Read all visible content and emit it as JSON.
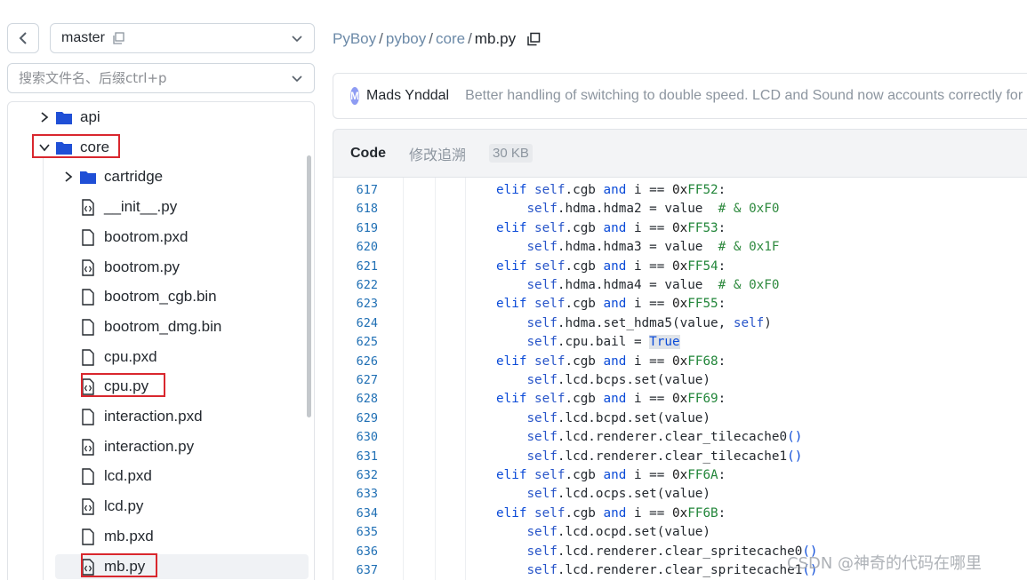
{
  "sidebar": {
    "branch": "master",
    "search_placeholder": "搜索文件名、后缀ctrl+p",
    "tree": [
      {
        "label": "api",
        "type": "folder",
        "expanded": false,
        "selected": false,
        "highlighted": false
      },
      {
        "label": "core",
        "type": "folder",
        "expanded": true,
        "selected": false,
        "highlighted": true
      },
      {
        "label": "cartridge",
        "type": "folder",
        "expanded": false,
        "selected": false,
        "highlighted": false
      },
      {
        "label": "__init__.py",
        "type": "code-file",
        "selected": false,
        "highlighted": false
      },
      {
        "label": "bootrom.pxd",
        "type": "file",
        "selected": false,
        "highlighted": false
      },
      {
        "label": "bootrom.py",
        "type": "code-file",
        "selected": false,
        "highlighted": false
      },
      {
        "label": "bootrom_cgb.bin",
        "type": "file",
        "selected": false,
        "highlighted": false
      },
      {
        "label": "bootrom_dmg.bin",
        "type": "file",
        "selected": false,
        "highlighted": false
      },
      {
        "label": "cpu.pxd",
        "type": "file",
        "selected": false,
        "highlighted": false
      },
      {
        "label": "cpu.py",
        "type": "code-file",
        "selected": false,
        "highlighted": true
      },
      {
        "label": "interaction.pxd",
        "type": "file",
        "selected": false,
        "highlighted": false
      },
      {
        "label": "interaction.py",
        "type": "code-file",
        "selected": false,
        "highlighted": false
      },
      {
        "label": "lcd.pxd",
        "type": "file",
        "selected": false,
        "highlighted": false
      },
      {
        "label": "lcd.py",
        "type": "code-file",
        "selected": false,
        "highlighted": false
      },
      {
        "label": "mb.pxd",
        "type": "file",
        "selected": false,
        "highlighted": false
      },
      {
        "label": "mb.py",
        "type": "code-file",
        "selected": true,
        "highlighted": true
      }
    ]
  },
  "breadcrumb": {
    "parts": [
      "PyBoy",
      "pyboy",
      "core"
    ],
    "separator": "/",
    "current": "mb.py"
  },
  "commit": {
    "avatar_letter": "M",
    "author": "Mads Ynddal",
    "message": "Better handling of switching to double speed. LCD and Sound now accounts correctly for double speed"
  },
  "code_header": {
    "tab_code": "Code",
    "tab_blame": "修改追溯",
    "size": "30 KB"
  },
  "code": {
    "lines": [
      {
        "n": "617",
        "t": "elif self.cgb and i == 0xFF52:"
      },
      {
        "n": "618",
        "t": "    self.hdma.hdma2 = value  # & 0xF0"
      },
      {
        "n": "619",
        "t": "elif self.cgb and i == 0xFF53:"
      },
      {
        "n": "620",
        "t": "    self.hdma.hdma3 = value  # & 0x1F"
      },
      {
        "n": "621",
        "t": "elif self.cgb and i == 0xFF54:"
      },
      {
        "n": "622",
        "t": "    self.hdma.hdma4 = value  # & 0xF0"
      },
      {
        "n": "623",
        "t": "elif self.cgb and i == 0xFF55:"
      },
      {
        "n": "624",
        "t": "    self.hdma.set_hdma5(value, self)"
      },
      {
        "n": "625",
        "t": "    self.cpu.bail = True"
      },
      {
        "n": "626",
        "t": "elif self.cgb and i == 0xFF68:"
      },
      {
        "n": "627",
        "t": "    self.lcd.bcps.set(value)"
      },
      {
        "n": "628",
        "t": "elif self.cgb and i == 0xFF69:"
      },
      {
        "n": "629",
        "t": "    self.lcd.bcpd.set(value)"
      },
      {
        "n": "630",
        "t": "    self.lcd.renderer.clear_tilecache0()"
      },
      {
        "n": "631",
        "t": "    self.lcd.renderer.clear_tilecache1()"
      },
      {
        "n": "632",
        "t": "elif self.cgb and i == 0xFF6A:"
      },
      {
        "n": "633",
        "t": "    self.lcd.ocps.set(value)"
      },
      {
        "n": "634",
        "t": "elif self.cgb and i == 0xFF6B:"
      },
      {
        "n": "635",
        "t": "    self.lcd.ocpd.set(value)"
      },
      {
        "n": "636",
        "t": "    self.lcd.renderer.clear_spritecache0()"
      },
      {
        "n": "637",
        "t": "    self.lcd.renderer.clear_spritecache1()"
      }
    ]
  },
  "watermark": "CSDN @神奇的代码在哪里",
  "colors": {
    "highlight_box": "#d9272e",
    "folder": "#1f4fd6",
    "keyword": "#0b4bd8",
    "line_number": "#1f6fb4",
    "comment": "#2f8a3f"
  }
}
